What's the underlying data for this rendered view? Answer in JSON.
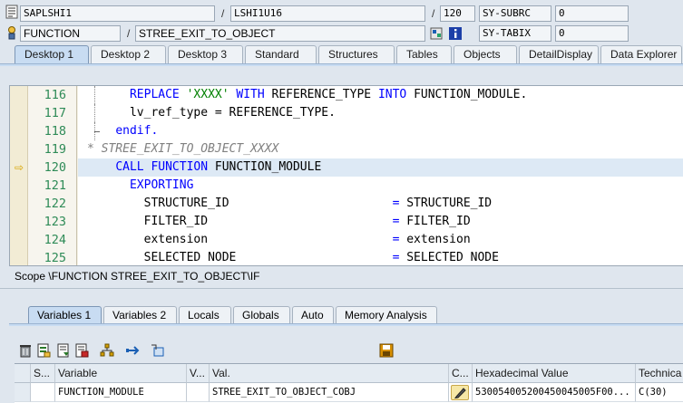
{
  "header": {
    "row1": {
      "program": "SAPLSHI1",
      "include": "LSHI1U16",
      "line": "120",
      "sysvar_label": "SY-SUBRC",
      "sysvar_value": "0"
    },
    "row2": {
      "event_type": "FUNCTION",
      "event_name": "STREE_EXIT_TO_OBJECT",
      "sysvar_label": "SY-TABIX",
      "sysvar_value": "0"
    }
  },
  "desktop_tabs": [
    "Desktop 1",
    "Desktop 2",
    "Desktop 3",
    "Standard",
    "Structures",
    "Tables",
    "Objects",
    "DetailDisplay",
    "Data Explorer"
  ],
  "desktop_active_tab": "Desktop 1",
  "editor": {
    "current_line": "120",
    "lines": [
      {
        "no": "116",
        "indent": "      ",
        "tokens": [
          {
            "t": "REPLACE",
            "c": "kw"
          },
          {
            "t": " "
          },
          {
            "t": "'XXXX'",
            "c": "str"
          },
          {
            "t": " "
          },
          {
            "t": "WITH",
            "c": "kw"
          },
          {
            "t": " REFERENCE_TYPE "
          },
          {
            "t": "INTO",
            "c": "kw"
          },
          {
            "t": " FUNCTION_MODULE."
          }
        ]
      },
      {
        "no": "117",
        "indent": "      ",
        "tokens": [
          {
            "t": "lv_ref_type = REFERENCE_TYPE."
          }
        ]
      },
      {
        "no": "118",
        "indent": "    ",
        "tokens": [
          {
            "t": "endif.",
            "c": "kw"
          }
        ]
      },
      {
        "no": "119",
        "indent": "",
        "tokens": [
          {
            "t": "* STREE_EXIT_TO_OBJECT_XXXX",
            "c": "cm"
          }
        ]
      },
      {
        "no": "120",
        "indent": "    ",
        "tokens": [
          {
            "t": "CALL FUNCTION",
            "c": "kw"
          },
          {
            "t": " FUNCTION_MODULE"
          }
        ]
      },
      {
        "no": "121",
        "indent": "      ",
        "tokens": [
          {
            "t": "EXPORTING",
            "c": "kw"
          }
        ]
      },
      {
        "no": "122",
        "indent": "        ",
        "tokens": [
          {
            "t": "STRUCTURE_ID                       "
          },
          {
            "t": "=",
            "c": "kw"
          },
          {
            "t": " STRUCTURE_ID"
          }
        ]
      },
      {
        "no": "123",
        "indent": "        ",
        "tokens": [
          {
            "t": "FILTER_ID                          "
          },
          {
            "t": "=",
            "c": "kw"
          },
          {
            "t": " FILTER_ID"
          }
        ]
      },
      {
        "no": "124",
        "indent": "        ",
        "tokens": [
          {
            "t": "extension                          "
          },
          {
            "t": "=",
            "c": "kw"
          },
          {
            "t": " extension"
          }
        ]
      },
      {
        "no": "125",
        "indent": "        ",
        "tokens": [
          {
            "t": "SELECTED NODE                      "
          },
          {
            "t": "=",
            "c": "kw"
          },
          {
            "t": " SELECTED NODE"
          }
        ]
      }
    ]
  },
  "scope_text": "Scope \\FUNCTION STREE_EXIT_TO_OBJECT\\IF",
  "variable_tabs": [
    "Variables 1",
    "Variables 2",
    "Locals",
    "Globals",
    "Auto",
    "Memory Analysis"
  ],
  "variable_active_tab": "Variables 1",
  "table": {
    "columns": [
      "S...",
      "Variable",
      "V...",
      "Val.",
      "C...",
      "Hexadecimal Value",
      "Technica"
    ],
    "rows": [
      {
        "variable": "FUNCTION_MODULE",
        "value": "STREE_EXIT_TO_OBJECT_COBJ",
        "hex": "530054005200450045005F00...",
        "tech": "C(30)"
      }
    ]
  },
  "colors": {
    "keyword": "#0000ff",
    "string": "#008000",
    "comment": "#808080",
    "line_number": "#2e8b57",
    "current_line": "#dde9f5",
    "tab_active": "#c8dcf2"
  }
}
